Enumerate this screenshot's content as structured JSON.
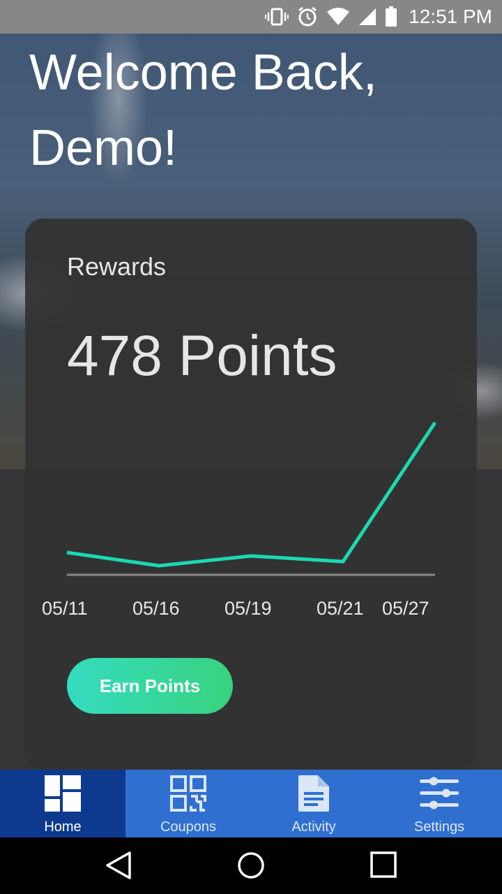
{
  "status_bar": {
    "time": "12:51 PM",
    "icons": [
      "vibrate-icon",
      "alarm-icon",
      "wifi-icon",
      "signal-icon",
      "battery-icon"
    ]
  },
  "welcome": {
    "text": "Welcome Back,\nDemo!"
  },
  "rewards_card": {
    "title": "Rewards",
    "points_text": "478 Points",
    "earn_button_label": "Earn Points"
  },
  "chart_data": {
    "type": "line",
    "categories": [
      "05/11",
      "05/16",
      "05/19",
      "05/21",
      "05/27"
    ],
    "x": [
      11,
      16,
      19,
      21,
      27
    ],
    "series": [
      {
        "values": [
          32,
          13,
          27,
          19,
          218
        ],
        "color": "#1ad9b1"
      }
    ],
    "xlabel": "",
    "ylabel": "",
    "grid": false,
    "ylim": [
      0,
      240
    ]
  },
  "bottom_nav": {
    "items": [
      {
        "label": "Home",
        "icon": "home-grid-icon",
        "active": true
      },
      {
        "label": "Coupons",
        "icon": "qr-code-icon",
        "active": false
      },
      {
        "label": "Activity",
        "icon": "document-icon",
        "active": false
      },
      {
        "label": "Settings",
        "icon": "sliders-icon",
        "active": false
      }
    ]
  },
  "colors": {
    "accent": "#1ad9b1",
    "nav_bg": "#2f6fd0",
    "nav_active_bg": "#0d3a8f",
    "button_gradient_start": "#35dcc0",
    "button_gradient_end": "#38d27e",
    "card_bg": "#323232"
  }
}
